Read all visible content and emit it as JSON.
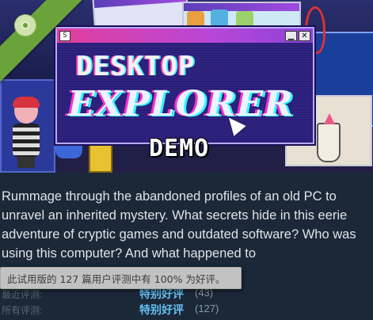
{
  "capsule": {
    "logo_line1": "DESKTOP",
    "logo_line2": "EXPLORER",
    "demo_label": "DEMO",
    "window_icon": "S",
    "minimize_glyph": "▁",
    "close_glyph": "✕"
  },
  "ribbon": {
    "icon": "disc-icon",
    "color": "#6aa33a"
  },
  "description": "Rummage through the abandoned profiles of an old PC to unravel an inherited mystery. What secrets hide in this eerie adventure of cryptic games and outdated software? Who was using this computer? And what happened to",
  "reviews": {
    "recent": {
      "label": "最近评测:",
      "summary": "特别好评",
      "count": "(43)"
    },
    "all": {
      "label": "所有评测:",
      "summary": "特别好评",
      "count": "(127)"
    }
  },
  "tooltip": {
    "text": "此试用版的 127 篇用户评测中有 100% 为好评。"
  },
  "colors": {
    "background": "#1b2838",
    "summary_link": "#66c0f4",
    "label": "#556772"
  }
}
